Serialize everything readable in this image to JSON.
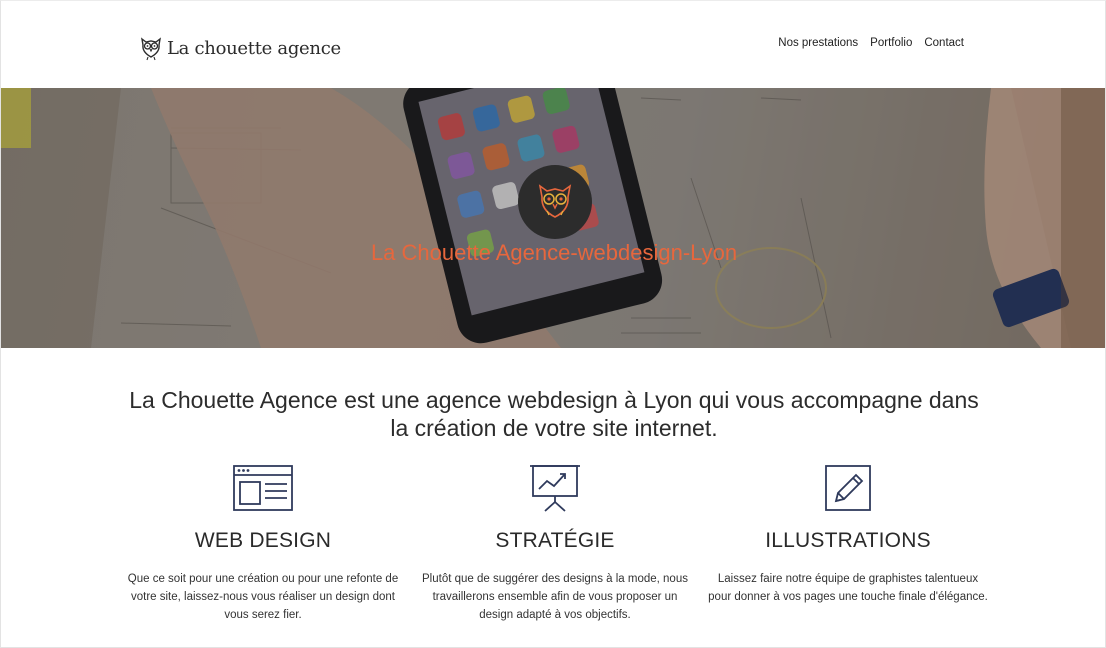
{
  "header": {
    "brand": "La chouette agence",
    "nav": [
      "Nos prestations",
      "Portfolio",
      "Contact"
    ]
  },
  "hero": {
    "title": "La Chouette Agence-webdesign-Lyon"
  },
  "intro": {
    "text": "La Chouette Agence est une agence webdesign à Lyon qui vous accompagne dans la création de votre site internet."
  },
  "features": [
    {
      "icon": "web-design-icon",
      "title": "WEB DESIGN",
      "text": "Que ce soit pour une création ou pour une refonte de votre site, laissez-nous vous réaliser un design dont vous serez fier."
    },
    {
      "icon": "strategy-icon",
      "title": "STRATÉGIE",
      "text": "Plutôt que de suggérer des designs à la mode, nous travaillerons ensemble afin de vous proposer un design adapté à vos objectifs."
    },
    {
      "icon": "illustration-icon",
      "title": "ILLUSTRATIONS",
      "text": "Laissez faire notre équipe de graphistes talentueux pour donner à vos pages une touche finale d'élégance."
    }
  ],
  "colors": {
    "accent": "#e7673d",
    "icon_stroke": "#2f3a5c",
    "text": "#2c2c2c"
  }
}
